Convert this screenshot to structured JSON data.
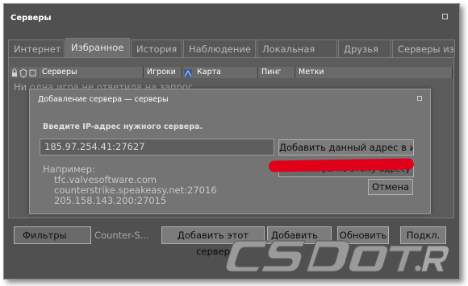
{
  "window": {
    "title": "Серверы"
  },
  "tabs": [
    "Интернет",
    "Избранное",
    "История",
    "Наблюдение",
    "Локальная сеть",
    "Друзья",
    "Серверы из ч"
  ],
  "columns": [
    "Серверы",
    "Игроки",
    "Карта",
    "Пинг",
    "Метки"
  ],
  "list_message": "Ни одна игра не ответила на запрос.",
  "dialog": {
    "title": "Добавление сервера — серверы",
    "prompt": "Введите IP-адрес нужного сервера.",
    "ip_value": "185.97.254.41:27627",
    "add_button": "Добавить данный адрес в из...",
    "example_label": "Например:",
    "examples": [
      "tfc.valvesoftware.com",
      "counterstrike.speakeasy.net:27016",
      "205.158.143.200:27015"
    ],
    "hidden_button": "Найти игры по этому адресу",
    "cancel_button": "Отмена"
  },
  "bottom": {
    "filters": "Фильтры",
    "game": "Counter-S...",
    "add_this": "Добавить этот сервер",
    "add": "Добавить",
    "refresh": "Обновить",
    "connect": "Подкл."
  },
  "watermark": "CSDot.RU",
  "colors": {
    "highlight": "#e0001a",
    "window_bg": "#505050",
    "dialog_bg": "#747474"
  }
}
